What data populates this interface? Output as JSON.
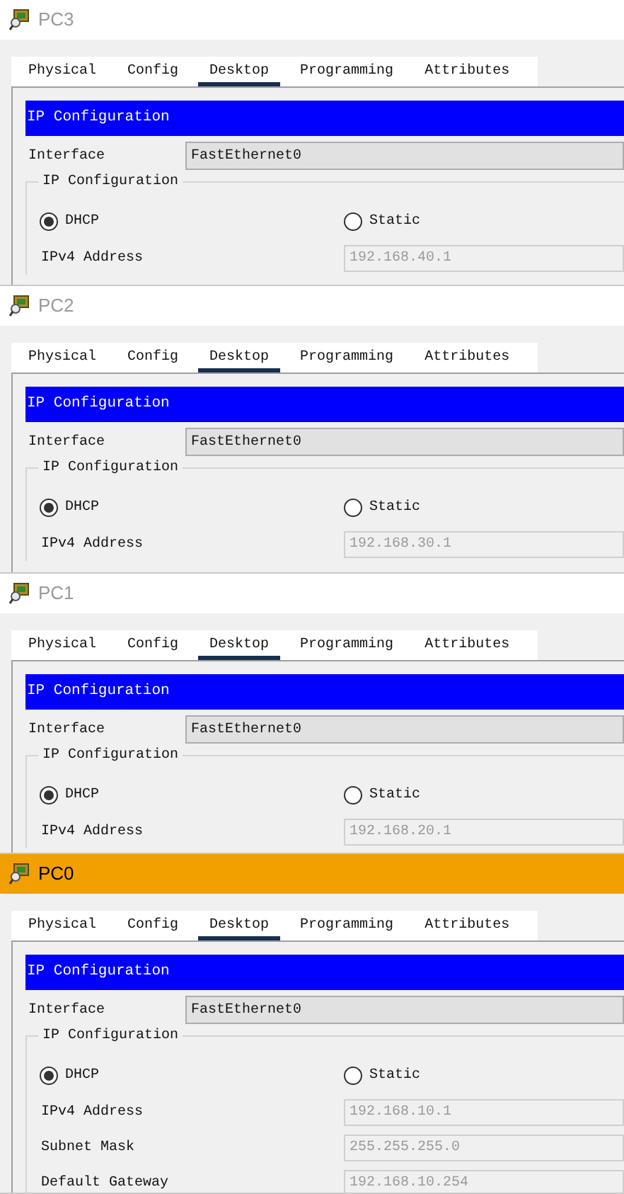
{
  "windows": [
    {
      "title": "PC3",
      "active": false,
      "tabs": [
        {
          "label": "Physical",
          "selected": false
        },
        {
          "label": "Config",
          "selected": false
        },
        {
          "label": "Desktop",
          "selected": true
        },
        {
          "label": "Programming",
          "selected": false
        },
        {
          "label": "Attributes",
          "selected": false
        }
      ],
      "header": "IP Configuration",
      "interface_label": "Interface",
      "interface_value": "FastEthernet0",
      "group_title": "IP Configuration",
      "radios": [
        {
          "label": "DHCP",
          "selected": true
        },
        {
          "label": "Static",
          "selected": false
        }
      ],
      "fields": [
        {
          "label": "IPv4 Address",
          "value": "192.168.40.1"
        }
      ]
    },
    {
      "title": "PC2",
      "active": false,
      "tabs": [
        {
          "label": "Physical",
          "selected": false
        },
        {
          "label": "Config",
          "selected": false
        },
        {
          "label": "Desktop",
          "selected": true
        },
        {
          "label": "Programming",
          "selected": false
        },
        {
          "label": "Attributes",
          "selected": false
        }
      ],
      "header": "IP Configuration",
      "interface_label": "Interface",
      "interface_value": "FastEthernet0",
      "group_title": "IP Configuration",
      "radios": [
        {
          "label": "DHCP",
          "selected": true
        },
        {
          "label": "Static",
          "selected": false
        }
      ],
      "fields": [
        {
          "label": "IPv4 Address",
          "value": "192.168.30.1"
        }
      ]
    },
    {
      "title": "PC1",
      "active": false,
      "tabs": [
        {
          "label": "Physical",
          "selected": false
        },
        {
          "label": "Config",
          "selected": false
        },
        {
          "label": "Desktop",
          "selected": true
        },
        {
          "label": "Programming",
          "selected": false
        },
        {
          "label": "Attributes",
          "selected": false
        }
      ],
      "header": "IP Configuration",
      "interface_label": "Interface",
      "interface_value": "FastEthernet0",
      "group_title": "IP Configuration",
      "radios": [
        {
          "label": "DHCP",
          "selected": true
        },
        {
          "label": "Static",
          "selected": false
        }
      ],
      "fields": [
        {
          "label": "IPv4 Address",
          "value": "192.168.20.1"
        }
      ]
    },
    {
      "title": "PC0",
      "active": true,
      "tabs": [
        {
          "label": "Physical",
          "selected": false
        },
        {
          "label": "Config",
          "selected": false
        },
        {
          "label": "Desktop",
          "selected": true
        },
        {
          "label": "Programming",
          "selected": false
        },
        {
          "label": "Attributes",
          "selected": false
        }
      ],
      "header": "IP Configuration",
      "interface_label": "Interface",
      "interface_value": "FastEthernet0",
      "group_title": "IP Configuration",
      "radios": [
        {
          "label": "DHCP",
          "selected": true
        },
        {
          "label": "Static",
          "selected": false
        }
      ],
      "fields": [
        {
          "label": "IPv4 Address",
          "value": "192.168.10.1"
        },
        {
          "label": "Subnet Mask",
          "value": "255.255.255.0"
        },
        {
          "label": "Default Gateway",
          "value": "192.168.10.254"
        }
      ]
    }
  ]
}
